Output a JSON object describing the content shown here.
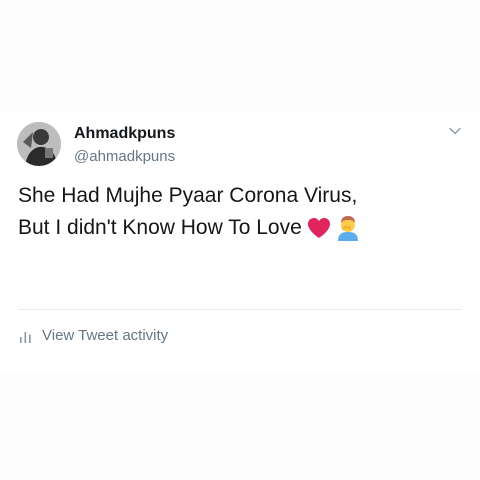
{
  "tweet": {
    "author": {
      "name": "Ahmadkpuns",
      "handle": "@ahmadkpuns",
      "avatar_icon": "profile-photo"
    },
    "text_lines": [
      "She Had Mujhe Pyaar Corona Virus,",
      "But I didn't Know How To Love"
    ],
    "emojis": [
      "red-heart-emoji",
      "man-facepalming-emoji"
    ],
    "menu_icon": "chevron-down-icon",
    "activity": {
      "icon": "bar-chart-icon",
      "label": "View Tweet activity"
    }
  },
  "colors": {
    "text": "#14171a",
    "secondary": "#657786",
    "divider": "#e8ecef",
    "heart": "#e0245e"
  }
}
